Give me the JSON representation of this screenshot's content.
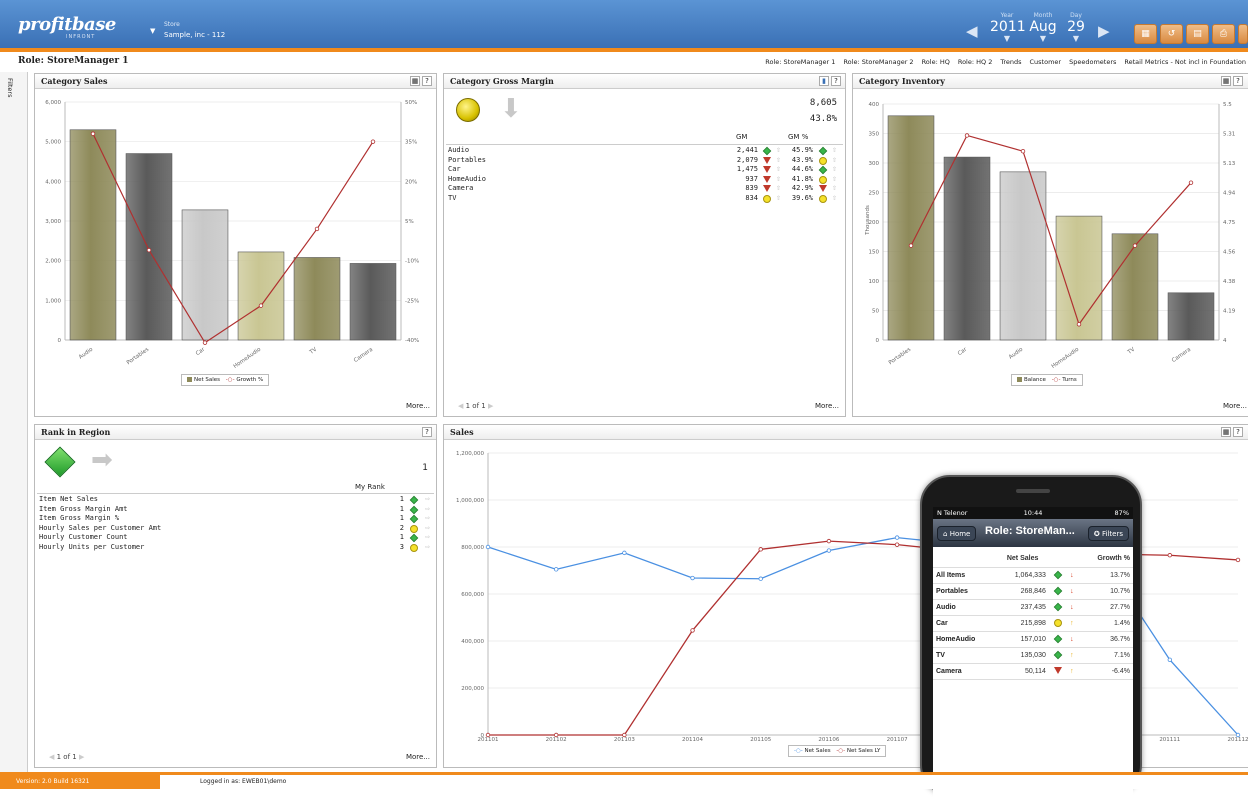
{
  "header": {
    "logo": "profitbase",
    "logo_sub": "INFRONT",
    "store_label": "Store",
    "store_value": "Sample, inc - 112",
    "year_label": "Year",
    "year_value": "2011",
    "month_label": "Month",
    "month_value": "Aug",
    "day_label": "Day",
    "day_value": "29"
  },
  "role_title": "Role: StoreManager 1",
  "role_links": [
    "Role: StoreManager 1",
    "Role: StoreManager 2",
    "Role: HQ",
    "Role: HQ 2",
    "Trends",
    "Customer",
    "Speedometers",
    "Retail Metrics - Not incl in Foundation"
  ],
  "filters_label": "Filters",
  "category_sales": {
    "title": "Category Sales",
    "more": "More...",
    "legend": [
      "Net Sales",
      "Growth %"
    ],
    "chart_data": {
      "type": "bar",
      "categories": [
        "Audio",
        "Portables",
        "Car",
        "HomeAudio",
        "TV",
        "Camera"
      ],
      "series": [
        {
          "name": "Net Sales",
          "values": [
            5300,
            4700,
            3280,
            2220,
            2080,
            1930
          ]
        },
        {
          "name": "Growth %",
          "values": [
            38,
            -6,
            -41,
            -27,
            2,
            35
          ]
        }
      ],
      "y_ticks": [
        "6,000",
        "5,000",
        "4,000",
        "3,000",
        "2,000",
        "1,000",
        "0"
      ],
      "y2_ticks": [
        "50%",
        "35%",
        "20%",
        "5%",
        "-10%",
        "-25%",
        "-40%"
      ],
      "ylim": [
        0,
        6000
      ],
      "y2lim": [
        -40,
        50
      ]
    }
  },
  "gross_margin": {
    "title": "Category Gross Margin",
    "total": "8,605",
    "total_pct": "43.8%",
    "col_gm": "GM",
    "col_gmpct": "GM %",
    "pager": "1 of 1",
    "more": "More...",
    "rows": [
      {
        "name": "Audio",
        "gm": "2,441",
        "pct": "45.9%"
      },
      {
        "name": "Portables",
        "gm": "2,079",
        "pct": "43.9%"
      },
      {
        "name": "Car",
        "gm": "1,475",
        "pct": "44.6%"
      },
      {
        "name": "HomeAudio",
        "gm": "937",
        "pct": "41.8%"
      },
      {
        "name": "Camera",
        "gm": "839",
        "pct": "42.9%"
      },
      {
        "name": "TV",
        "gm": "834",
        "pct": "39.6%"
      }
    ]
  },
  "category_inventory": {
    "title": "Category Inventory",
    "more": "More...",
    "legend": [
      "Balance",
      "Turns"
    ],
    "y_axis_label": "Thousands",
    "chart_data": {
      "type": "bar",
      "categories": [
        "Portables",
        "Car",
        "Audio",
        "HomeAudio",
        "TV",
        "Camera"
      ],
      "series": [
        {
          "name": "Balance",
          "values": [
            380,
            310,
            285,
            210,
            180,
            80
          ]
        },
        {
          "name": "Turns",
          "values": [
            4.6,
            5.3,
            5.2,
            4.1,
            4.6,
            5.0
          ]
        }
      ],
      "y_ticks": [
        "400",
        "350",
        "300",
        "250",
        "200",
        "150",
        "100",
        "50",
        "0"
      ],
      "y2_ticks": [
        "5.5",
        "5.31",
        "5.13",
        "4.94",
        "4.75",
        "4.56",
        "4.38",
        "4.19",
        "4"
      ],
      "ylim": [
        0,
        400
      ],
      "y2lim": [
        4,
        5.5
      ]
    }
  },
  "rank_region": {
    "title": "Rank in Region",
    "value": "1",
    "col": "My Rank",
    "pager": "1 of 1",
    "more": "More...",
    "rows": [
      {
        "name": "Item Net Sales",
        "rank": "1",
        "icon": "green-diamond"
      },
      {
        "name": "Item Gross Margin Amt",
        "rank": "1",
        "icon": "green-diamond"
      },
      {
        "name": "Item Gross Margin %",
        "rank": "1",
        "icon": "green-diamond"
      },
      {
        "name": "Hourly Sales per Customer Amt",
        "rank": "2",
        "icon": "yellow-circle"
      },
      {
        "name": "Hourly Customer Count",
        "rank": "1",
        "icon": "green-diamond"
      },
      {
        "name": "Hourly Units per Customer",
        "rank": "3",
        "icon": "yellow-circle"
      }
    ]
  },
  "sales": {
    "title": "Sales",
    "legend": [
      "Net Sales",
      "Net Sales LY"
    ],
    "chart_data": {
      "type": "line",
      "x": [
        "201101",
        "201102",
        "201103",
        "201104",
        "201105",
        "201106",
        "201107",
        "201108",
        "201109",
        "201110",
        "201111",
        "201112"
      ],
      "series": [
        {
          "name": "Net Sales",
          "values": [
            800000,
            705000,
            775000,
            668000,
            665000,
            785000,
            840000,
            810000,
            800000,
            760000,
            320000,
            0
          ]
        },
        {
          "name": "Net Sales LY",
          "values": [
            0,
            0,
            0,
            445000,
            790000,
            825000,
            810000,
            780000,
            820000,
            770000,
            765000,
            745000
          ]
        }
      ],
      "y_ticks": [
        "1,200,000",
        "1,000,000",
        "800,000",
        "600,000",
        "400,000",
        "200,000",
        "0"
      ],
      "ylim": [
        0,
        1200000
      ]
    }
  },
  "phone": {
    "carrier": "N Telenor",
    "time": "10:44",
    "battery": "87%",
    "home": "Home",
    "title": "Role: StoreMan...",
    "filters": "Filters",
    "col1": "Net Sales",
    "col2": "Growth %",
    "rows": [
      {
        "name": "All Items",
        "sales": "1,064,333",
        "growth": "13.7%"
      },
      {
        "name": "Portables",
        "sales": "268,846",
        "growth": "10.7%"
      },
      {
        "name": "Audio",
        "sales": "237,435",
        "growth": "27.7%"
      },
      {
        "name": "Car",
        "sales": "215,898",
        "growth": "1.4%"
      },
      {
        "name": "HomeAudio",
        "sales": "157,010",
        "growth": "36.7%"
      },
      {
        "name": "TV",
        "sales": "135,030",
        "growth": "7.1%"
      },
      {
        "name": "Camera",
        "sales": "50,114",
        "growth": "-6.4%"
      }
    ]
  },
  "footer": {
    "version": "Version: 2.0 Build 16321",
    "user": "Logged in as: EWEB01\\demo"
  },
  "colors": {
    "olive": "#8e8a5a",
    "dark": "#5a5a5a",
    "light": "#c8c8c8",
    "khaki": "#c9c693",
    "line_red": "#b03030",
    "line_blue": "#4a90e2",
    "accent": "#f08a1c"
  }
}
